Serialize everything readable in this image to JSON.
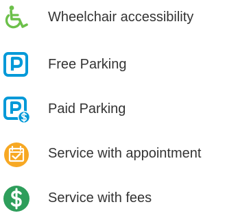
{
  "legend": {
    "items": [
      {
        "icon": "wheelchair-icon",
        "label": "Wheelchair accessibility",
        "color": "#6cc04a"
      },
      {
        "icon": "free-parking-icon",
        "label": "Free Parking",
        "color": "#0099d8"
      },
      {
        "icon": "paid-parking-icon",
        "label": "Paid Parking",
        "color": "#0099d8"
      },
      {
        "icon": "appointment-calendar-icon",
        "label": "Service with appointment",
        "color": "#f7a823"
      },
      {
        "icon": "fees-dollar-icon",
        "label": "Service with fees",
        "color": "#2e9e5b"
      }
    ]
  }
}
